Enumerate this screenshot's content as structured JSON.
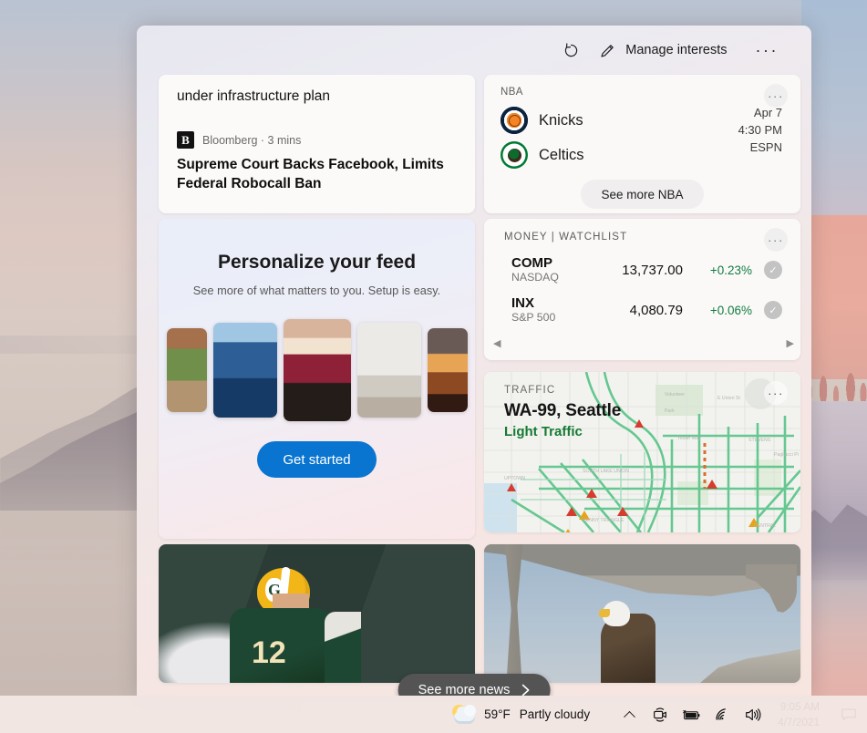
{
  "header": {
    "refresh_icon": "refresh-icon",
    "manage_interests_label": "Manage interests",
    "pencil_icon": "pencil-icon",
    "more_label": "···"
  },
  "news_card": {
    "previous_title_fragment": "under infrastructure plan",
    "source": "Bloomberg · 3 mins",
    "source_logo_letter": "B",
    "headline": "Supreme Court Backs Facebook, Limits Federal Robocall Ban"
  },
  "nba_card": {
    "label": "NBA",
    "more_label": "···",
    "teams": [
      {
        "name": "Knicks",
        "logo": "knicks-logo"
      },
      {
        "name": "Celtics",
        "logo": "celtics-logo"
      }
    ],
    "game_date": "Apr 7",
    "game_time": "4:30 PM",
    "game_channel": "ESPN",
    "cta_label": "See more NBA"
  },
  "personalize_card": {
    "title": "Personalize your feed",
    "subtitle": "See more of what matters to you. Setup is easy.",
    "button_label": "Get started",
    "thumbnails": [
      {
        "name": "garden-photo"
      },
      {
        "name": "city-skyline-photo"
      },
      {
        "name": "dessert-photo"
      },
      {
        "name": "interior-design-photo"
      },
      {
        "name": "sunset-car-photo"
      }
    ]
  },
  "watchlist_card": {
    "label": "MONEY | WATCHLIST",
    "more_label": "···",
    "prev_arrow": "◀",
    "next_arrow": "▶",
    "rows": [
      {
        "ticker": "COMP",
        "exchange": "NASDAQ",
        "price": "13,737.00",
        "change": "+0.23%",
        "status_icon": "check-circle-icon"
      },
      {
        "ticker": "INX",
        "exchange": "S&P 500",
        "price": "4,080.79",
        "change": "+0.06%",
        "status_icon": "check-circle-icon"
      }
    ],
    "positive_color": "#107c41"
  },
  "traffic_card": {
    "label": "TRAFFIC",
    "more_label": "···",
    "road": "WA-99, Seattle",
    "status": "Light Traffic",
    "status_color": "#157a33",
    "map_labels": [
      "UPTOWN",
      "SOUTH LAKE UNION",
      "DENNY TRIANGLE",
      "STEVENS",
      "CENTRAL"
    ]
  },
  "photo_cards": [
    {
      "name": "packers-quarterback-photo"
    },
    {
      "name": "bald-eagle-photo"
    }
  ],
  "see_more_news": {
    "label": "See more news",
    "chevron": "›"
  },
  "taskbar": {
    "weather_temp": "59°F",
    "weather_condition": "Partly cloudy",
    "weather_icon": "partly-cloudy-icon",
    "tray_icons": [
      "chevron-up-icon",
      "meet-now-icon",
      "battery-icon",
      "wifi-icon",
      "volume-icon"
    ],
    "time": "9:05 AM",
    "date": "4/7/2021",
    "action_center_icon": "notification-icon"
  }
}
